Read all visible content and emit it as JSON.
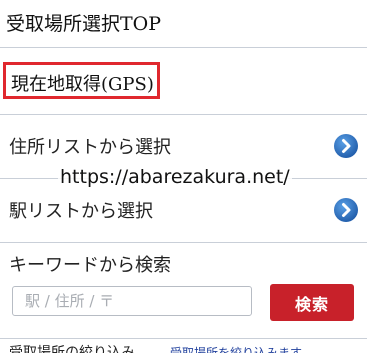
{
  "header": {
    "title": "受取場所選択TOP"
  },
  "gps": {
    "label": "現在地取得(GPS)"
  },
  "list": {
    "items": [
      {
        "label": "住所リストから選択",
        "icon": "chevron-right-circle-icon"
      },
      {
        "label": "駅リストから選択",
        "icon": "chevron-right-circle-icon"
      }
    ]
  },
  "watermark": {
    "text": "https://abarezakura.net/"
  },
  "keyword": {
    "label": "キーワードから検索",
    "placeholder": "駅 / 住所 / 〒",
    "value": "",
    "button_label": "検索"
  },
  "footer": {
    "label": "受取場所の絞り込み",
    "link": "受取場所を絞り込みます"
  },
  "colors": {
    "accent_red": "#e0282e",
    "button_red": "#c8212a",
    "chevron_blue": "#2f73c3",
    "divider": "#c9cfd8"
  }
}
